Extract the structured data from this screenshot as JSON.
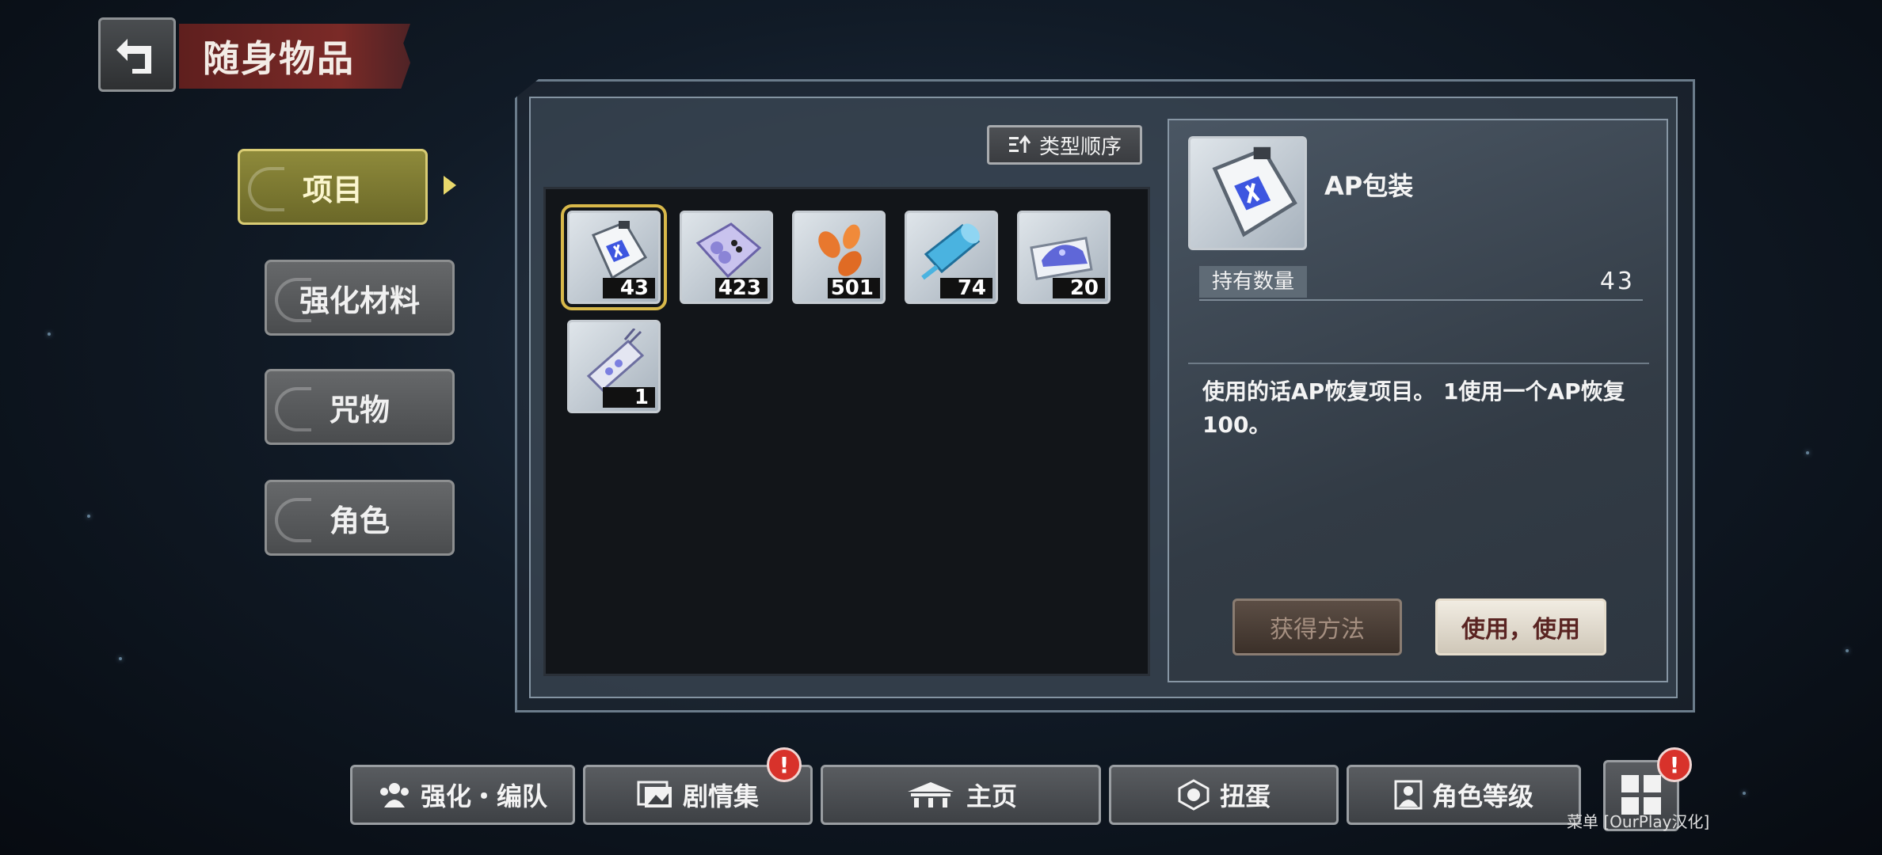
{
  "header": {
    "title": "随身物品"
  },
  "categories": [
    {
      "label": "项目",
      "active": true
    },
    {
      "label": "强化材料",
      "active": false
    },
    {
      "label": "咒物",
      "active": false
    },
    {
      "label": "角色",
      "active": false
    }
  ],
  "toolbar": {
    "sort_label": "类型顺序"
  },
  "items": [
    {
      "name": "ap-package",
      "qty": "43",
      "selected": true
    },
    {
      "name": "crystal-sheet",
      "qty": "423"
    },
    {
      "name": "orange-leaves",
      "qty": "501"
    },
    {
      "name": "blue-scroll",
      "qty": "74"
    },
    {
      "name": "blue-crystal-pile",
      "qty": "20"
    },
    {
      "name": "crystal-tag",
      "qty": "1"
    }
  ],
  "detail": {
    "name": "AP包装",
    "qty_label": "持有数量",
    "qty_value": "43",
    "description": "使用的话AP恢复项目。 1使用一个AP恢复100。",
    "obtain_label": "获得方法",
    "use_label": "使用，使用"
  },
  "nav": {
    "items": [
      {
        "label": "强化・编队"
      },
      {
        "label": "剧情集",
        "badge": "!"
      },
      {
        "label": "主页"
      },
      {
        "label": "扭蛋"
      },
      {
        "label": "角色等级"
      }
    ],
    "menu_badge": "!",
    "menu_label": "菜单 [OurPlay汉化]"
  },
  "colors": {
    "accent_active": "#d9cc74",
    "title_banner": "#7a2a27",
    "badge": "#d8322b"
  }
}
